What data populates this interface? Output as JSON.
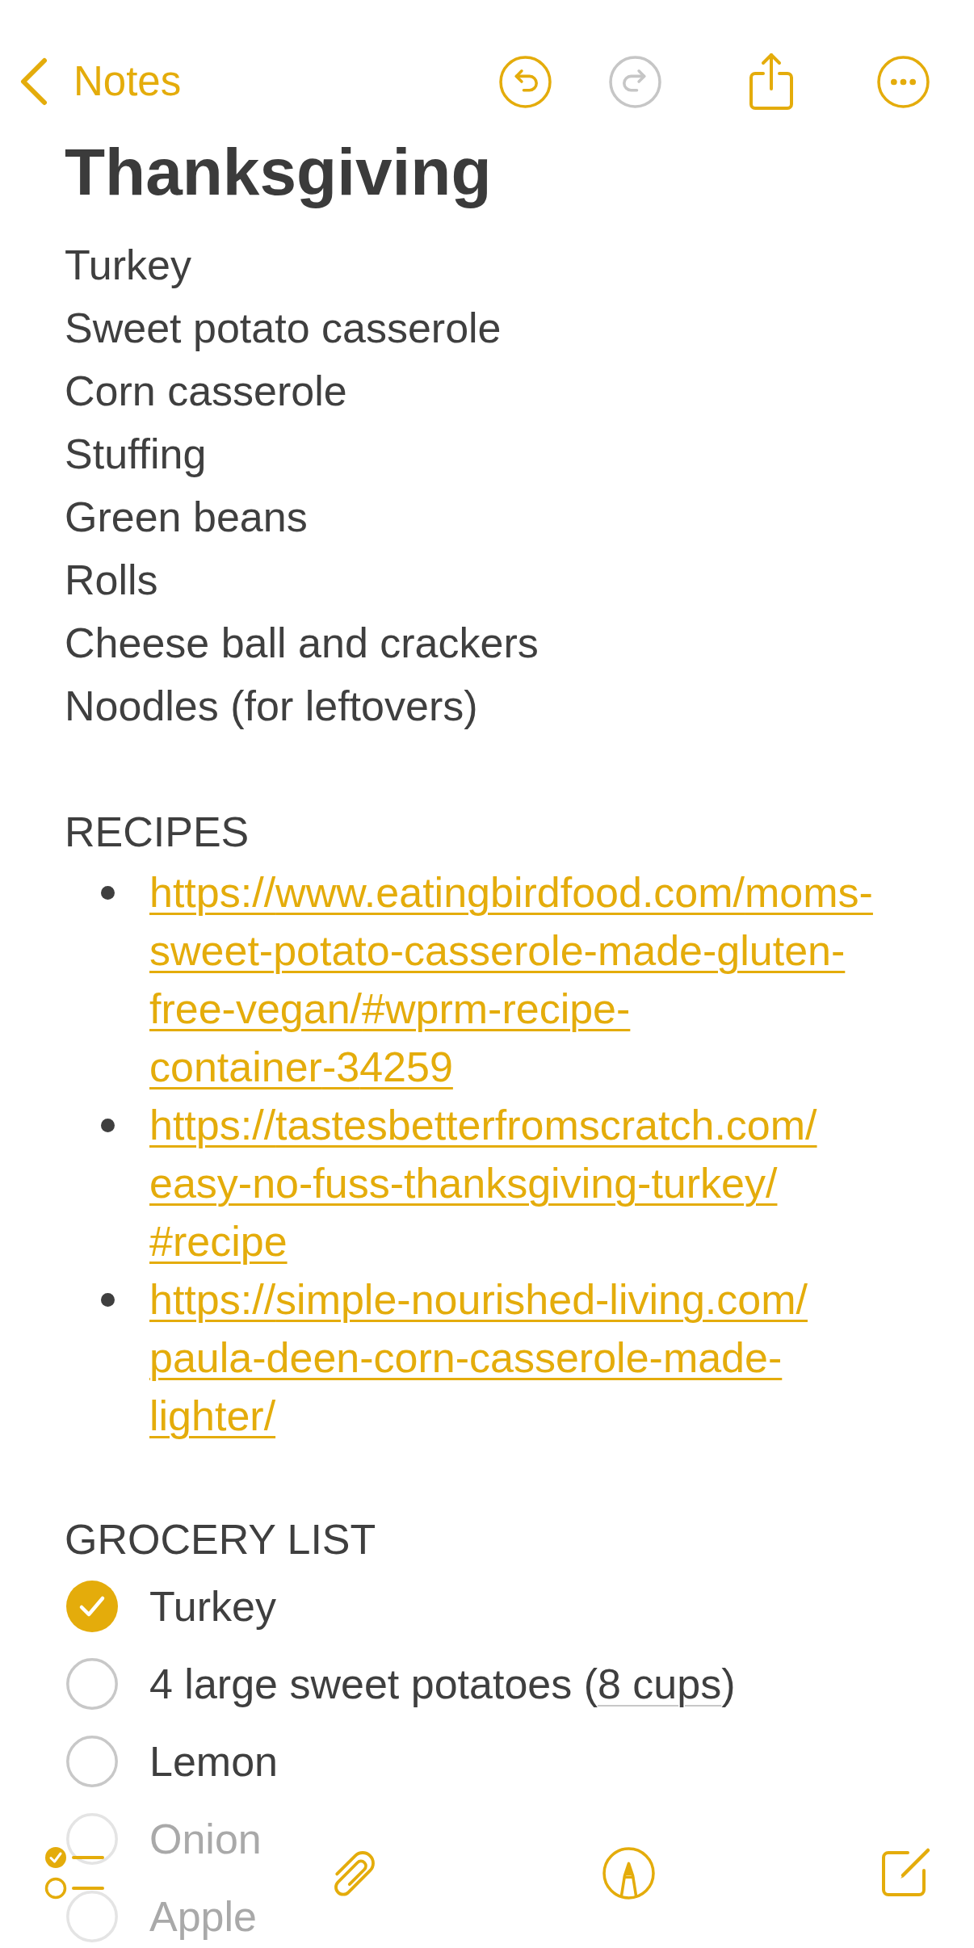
{
  "nav": {
    "back": {
      "label": "Notes"
    },
    "actions": [
      {
        "kind": "undo",
        "disabled": false
      },
      {
        "kind": "redo",
        "disabled": true
      },
      {
        "kind": "share",
        "disabled": false
      },
      {
        "kind": "more",
        "disabled": false
      }
    ]
  },
  "note": {
    "title": "Thanksgiving",
    "lines": [
      "Turkey",
      "Sweet potato casserole",
      "Corn casserole",
      "Stuffing",
      "Green beans",
      "Rolls",
      "Cheese ball and crackers",
      "Noodles (for leftovers)"
    ],
    "sections": [
      {
        "heading": "RECIPES",
        "kind": "bullets",
        "items": [
          {
            "url": "https://www.eatingbirdfood.com/moms-sweet-potato-casserole-made-gluten-free-vegan/#wprm-recipe-container-34259"
          },
          {
            "url": "https://tastesbetterfromscratch.com/easy-no-fuss-thanksgiving-turkey/#recipe"
          },
          {
            "url": "https://simple-nourished-living.com/paula-deen-corn-casserole-made-lighter/"
          }
        ]
      },
      {
        "heading": "GROCERY LIST",
        "kind": "checklist",
        "items": [
          {
            "parts": [
              {
                "text": "Turkey"
              }
            ],
            "checked": true,
            "dimmed": false
          },
          {
            "parts": [
              {
                "text": "4 large sweet potatoes ("
              },
              {
                "text": "8 cups",
                "detected": true
              },
              {
                "text": ")"
              }
            ],
            "checked": false,
            "dimmed": false
          },
          {
            "parts": [
              {
                "text": "Lemon"
              }
            ],
            "checked": false,
            "dimmed": false
          },
          {
            "parts": [
              {
                "text": "Onion"
              }
            ],
            "checked": false,
            "dimmed": true
          },
          {
            "parts": [
              {
                "text": "Apple"
              }
            ],
            "checked": false,
            "dimmed": true
          }
        ]
      }
    ]
  },
  "toolbar": [
    {
      "kind": "checklist"
    },
    {
      "kind": "attach"
    },
    {
      "kind": "markup"
    },
    {
      "kind": "compose"
    }
  ]
}
